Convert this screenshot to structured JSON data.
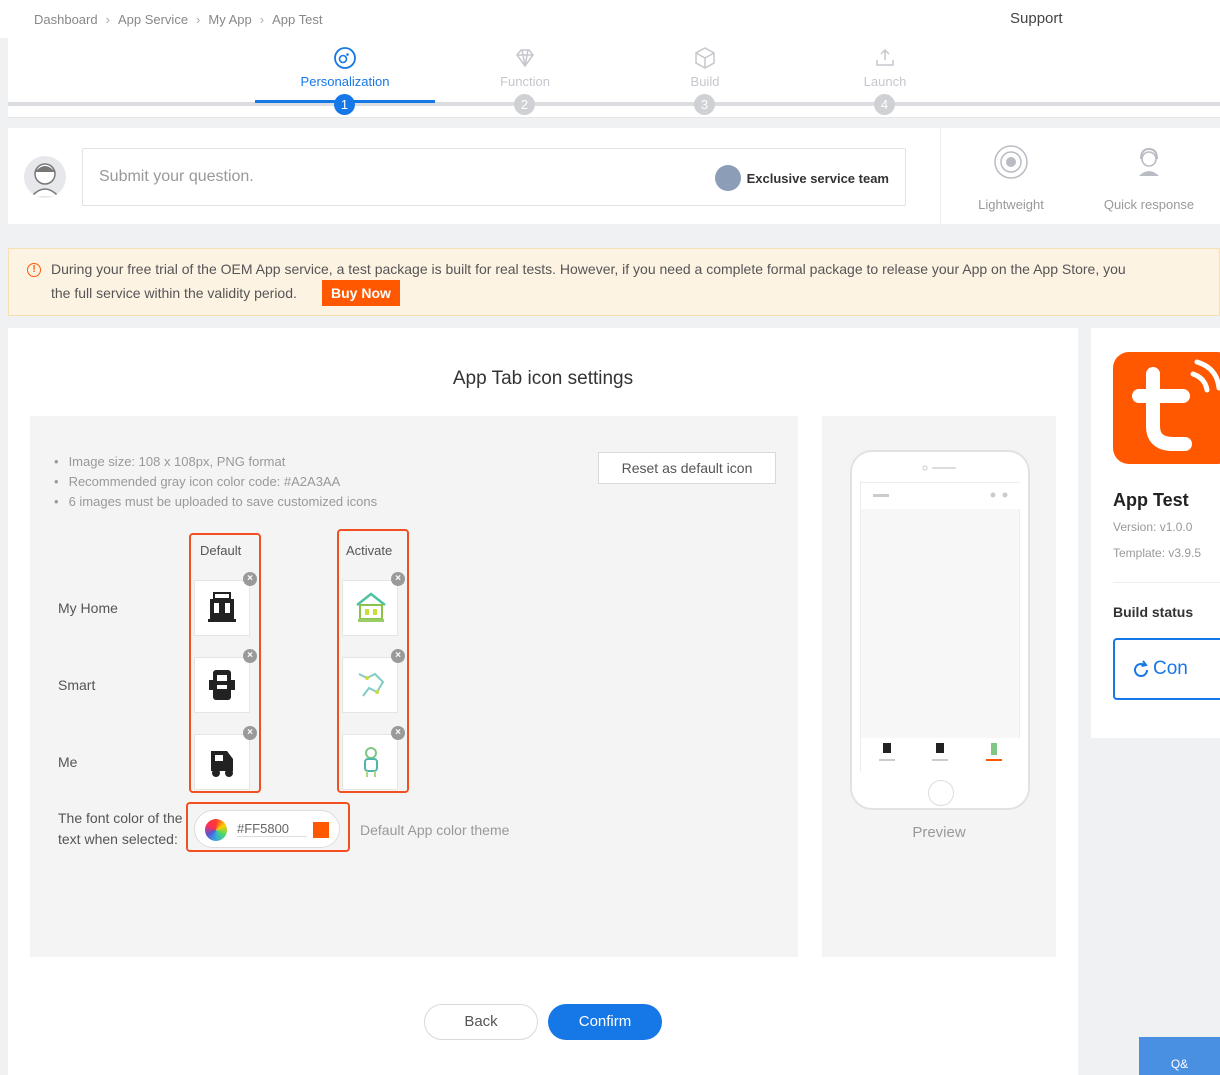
{
  "breadcrumb": [
    "Dashboard",
    "App Service",
    "My App",
    "App Test"
  ],
  "support_label": "Support",
  "steps": [
    {
      "label": "Personalization",
      "number": "1"
    },
    {
      "label": "Function",
      "number": "2"
    },
    {
      "label": "Build",
      "number": "3"
    },
    {
      "label": "Launch",
      "number": "4"
    }
  ],
  "question": {
    "placeholder": "Submit your question.",
    "service_team": "Exclusive service team"
  },
  "features": [
    {
      "label": "Lightweight",
      "icon": "target-icon"
    },
    {
      "label": "Quick response",
      "icon": "support-agent-icon"
    }
  ],
  "notice": {
    "line1": "During your free trial of the OEM App service, a test package is built for real tests. However, if you need a complete formal package to release your App on the App Store, you",
    "line2": "the full service within the validity period.",
    "buy_label": "Buy Now"
  },
  "settings": {
    "title": "App Tab icon settings",
    "rules": [
      "Image size: 108 x 108px, PNG format",
      "Recommended gray icon color code: #A2A3AA",
      "6 images must be uploaded to save customized icons"
    ],
    "reset_label": "Reset as default icon",
    "col_default": "Default",
    "col_activate": "Activate",
    "rows": [
      {
        "label": "My Home",
        "icon": "home-device-icon"
      },
      {
        "label": "Smart",
        "icon": "smart-device-icon"
      },
      {
        "label": "Me",
        "icon": "profile-icon"
      }
    ],
    "remove_glyph": "×",
    "font_color_label_1": "The font color of the",
    "font_color_label_2": "text when selected:",
    "color_hex": "#FF5800",
    "color_value": "#FF5800",
    "theme_label": "Default App color theme",
    "preview_label": "Preview"
  },
  "actions": {
    "back": "Back",
    "confirm": "Confirm"
  },
  "app": {
    "name": "App Test",
    "version": "Version: v1.0.0",
    "template": "Template: v3.9.5",
    "build_status_label": "Build status",
    "build_status_button": "Con",
    "logo_letter": "t"
  },
  "fab_label": "Q&",
  "colors": {
    "accent": "#1677e6",
    "brand": "#FF5800",
    "highlight": "#f25022"
  }
}
